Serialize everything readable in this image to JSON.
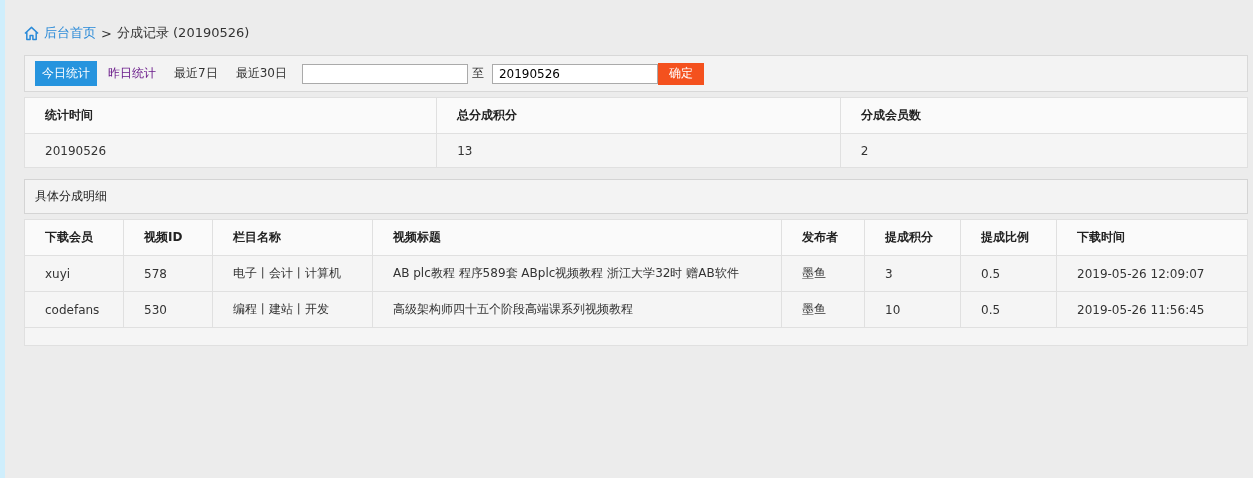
{
  "breadcrumb": {
    "home": "后台首页",
    "separator": ">",
    "current": "分成记录 (20190526)"
  },
  "filter": {
    "tabs": [
      {
        "label": "今日统计",
        "selected": true,
        "visited": false
      },
      {
        "label": "昨日统计",
        "selected": false,
        "visited": true
      },
      {
        "label": "最近7日",
        "selected": false,
        "visited": false
      },
      {
        "label": "最近30日",
        "selected": false,
        "visited": false
      }
    ],
    "to_label": "至",
    "end_date": "20190526",
    "submit": "确定"
  },
  "summary": {
    "columns": [
      "统计时间",
      "总分成积分",
      "分成会员数"
    ],
    "rows": [
      [
        "20190526",
        "13",
        "2"
      ]
    ]
  },
  "detail": {
    "title": "具体分成明细",
    "columns": [
      "下载会员",
      "视频ID",
      "栏目名称",
      "视频标题",
      "发布者",
      "提成积分",
      "提成比例",
      "下载时间"
    ],
    "rows": [
      [
        "xuyi",
        "578",
        "电子丨会计丨计算机",
        "AB plc教程 程序589套 ABplc视频教程 浙江大学32时 赠AB软件",
        "墨鱼",
        "3",
        "0.5",
        "2019-05-26 12:09:07"
      ],
      [
        "codefans",
        "530",
        "编程丨建站丨开发",
        "高级架构师四十五个阶段高端课系列视频教程",
        "墨鱼",
        "10",
        "0.5",
        "2019-05-26 11:56:45"
      ]
    ]
  }
}
